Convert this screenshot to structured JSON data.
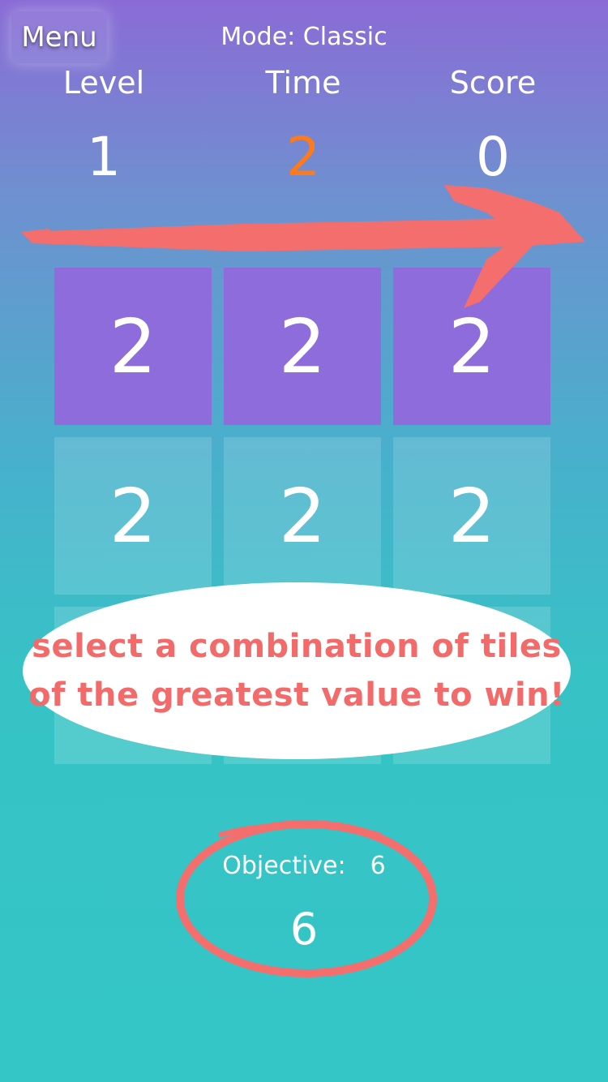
{
  "header": {
    "menu_label": "Menu",
    "mode_text": "Mode: Classic",
    "level_label": "Level",
    "time_label": "Time",
    "score_label": "Score",
    "level_value": "1",
    "time_value": "2",
    "score_value": "0"
  },
  "grid": {
    "tiles": [
      "2",
      "2",
      "2",
      "2",
      "2",
      "2"
    ]
  },
  "tutorial": {
    "line1": "select a combination of tiles",
    "line2": "of the greatest value to win!"
  },
  "objective": {
    "label": "Objective:",
    "target": "6",
    "current": "6"
  },
  "colors": {
    "accent_time": "#ff7a1a",
    "annotation": "#f56e6e",
    "selected_tile": "#8e6cdb"
  }
}
